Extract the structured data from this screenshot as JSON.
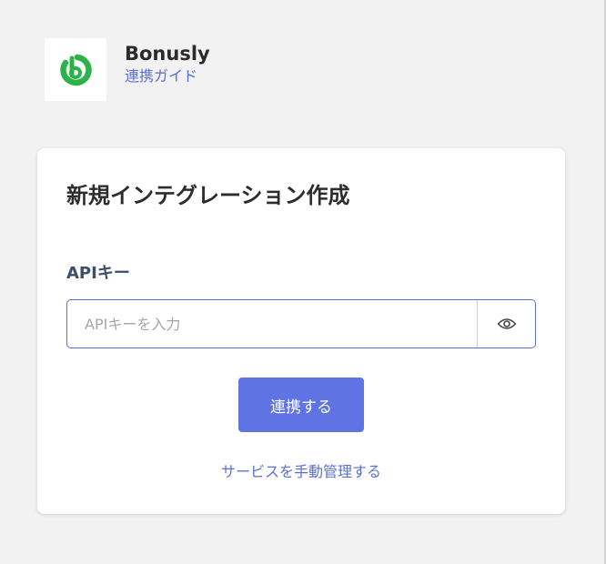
{
  "app": {
    "name": "Bonusly",
    "guide_link": "連携ガイド",
    "logo_icon": "bonusly-logo",
    "logo_color": "#2bb34a"
  },
  "card": {
    "title": "新規インテグレーション作成",
    "api_key_label": "APIキー",
    "api_key_value": "",
    "api_key_placeholder": "APIキーを入力",
    "visibility_icon": "eye-icon",
    "connect_button": "連携する",
    "manual_link": "サービスを手動管理する"
  },
  "colors": {
    "accent": "#5f73e3",
    "link": "#5a6fd6",
    "background": "#f2f2f2"
  }
}
